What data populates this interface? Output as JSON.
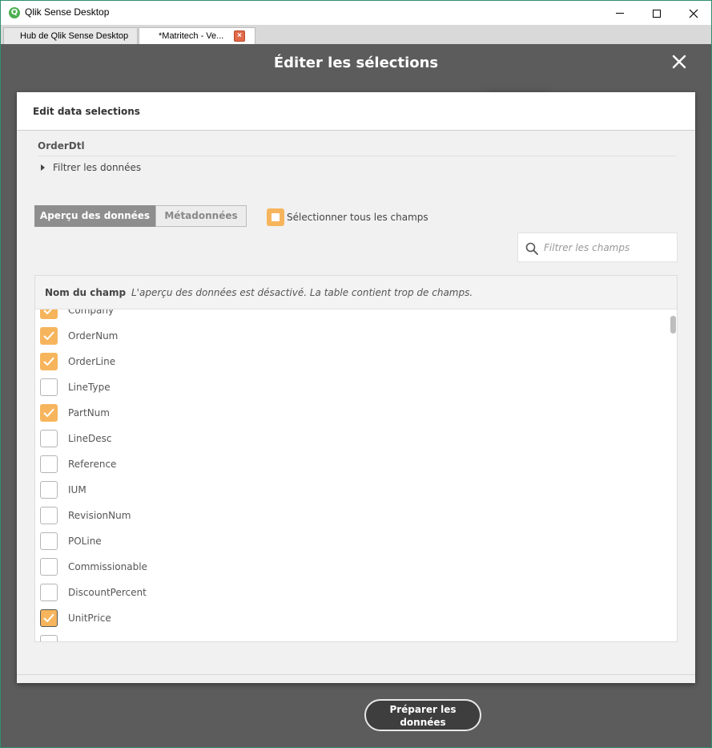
{
  "window": {
    "title": "Qlik Sense Desktop",
    "app_icon_glyph": "Q"
  },
  "tabs": [
    {
      "label": "Hub de Qlik Sense Desktop"
    },
    {
      "label": "*Matritech - Ve..."
    }
  ],
  "modal": {
    "title": "Éditer les sélections"
  },
  "dialog": {
    "header": "Edit data selections",
    "table_name": "OrderDtl",
    "filter_toggle_label": "Filtrer les données",
    "segments": {
      "preview": "Aperçu des données",
      "metadata": "Métadonnées"
    },
    "select_all_label": "Sélectionner tous les champs",
    "search": {
      "placeholder": "Filtrer les champs"
    },
    "field_column_header": "Nom du champ",
    "preview_notice": "L'aperçu des données est désactivé. La table contient trop de champs.",
    "fields": [
      {
        "name": "Company",
        "checked": true
      },
      {
        "name": "OrderNum",
        "checked": true
      },
      {
        "name": "OrderLine",
        "checked": true
      },
      {
        "name": "LineType",
        "checked": false
      },
      {
        "name": "PartNum",
        "checked": true
      },
      {
        "name": "LineDesc",
        "checked": false
      },
      {
        "name": "Reference",
        "checked": false
      },
      {
        "name": "IUM",
        "checked": false
      },
      {
        "name": "RevisionNum",
        "checked": false
      },
      {
        "name": "POLine",
        "checked": false
      },
      {
        "name": "Commissionable",
        "checked": false
      },
      {
        "name": "DiscountPercent",
        "checked": false
      },
      {
        "name": "UnitPrice",
        "checked": true
      }
    ]
  },
  "footer": {
    "prepare_button": "Préparer les données"
  },
  "colors": {
    "accent": "#f6b55d",
    "backdrop": "#5c5c5c"
  }
}
